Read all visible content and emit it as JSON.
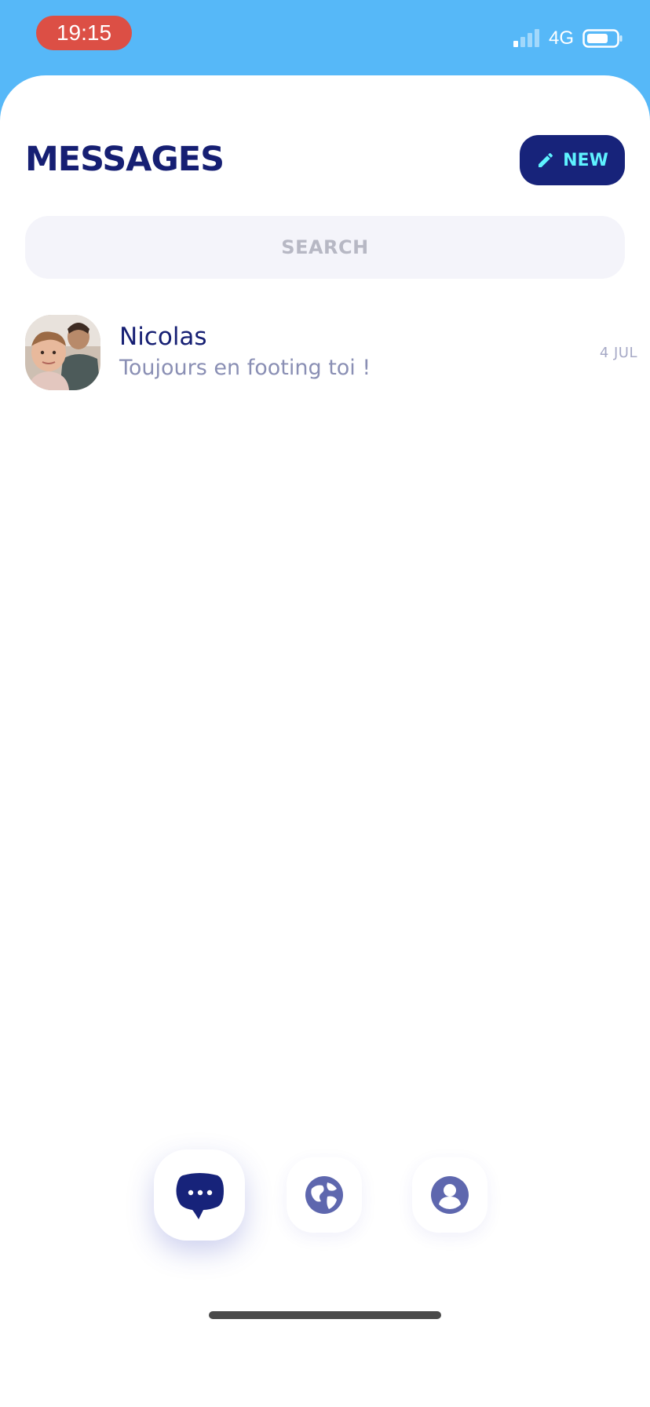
{
  "status_bar": {
    "time": "19:15",
    "network": "4G",
    "time_pill_color": "#dc4f45"
  },
  "header": {
    "title": "MESSAGES",
    "new_button_label": "NEW",
    "new_button_icon": "pencil-icon"
  },
  "search": {
    "placeholder": "SEARCH"
  },
  "conversations": [
    {
      "name": "Nicolas",
      "preview": "Toujours en footing toi !",
      "date": "4 JUL"
    }
  ],
  "bottom_nav": {
    "items": [
      {
        "icon": "chat-bubble-icon",
        "active": true
      },
      {
        "icon": "globe-icon",
        "active": false
      },
      {
        "icon": "profile-icon",
        "active": false
      }
    ]
  },
  "colors": {
    "status_bar_bg": "#56b8f8",
    "primary": "#161f73",
    "accent": "#5ef2ff",
    "secondary_text": "#8a8fb4"
  }
}
